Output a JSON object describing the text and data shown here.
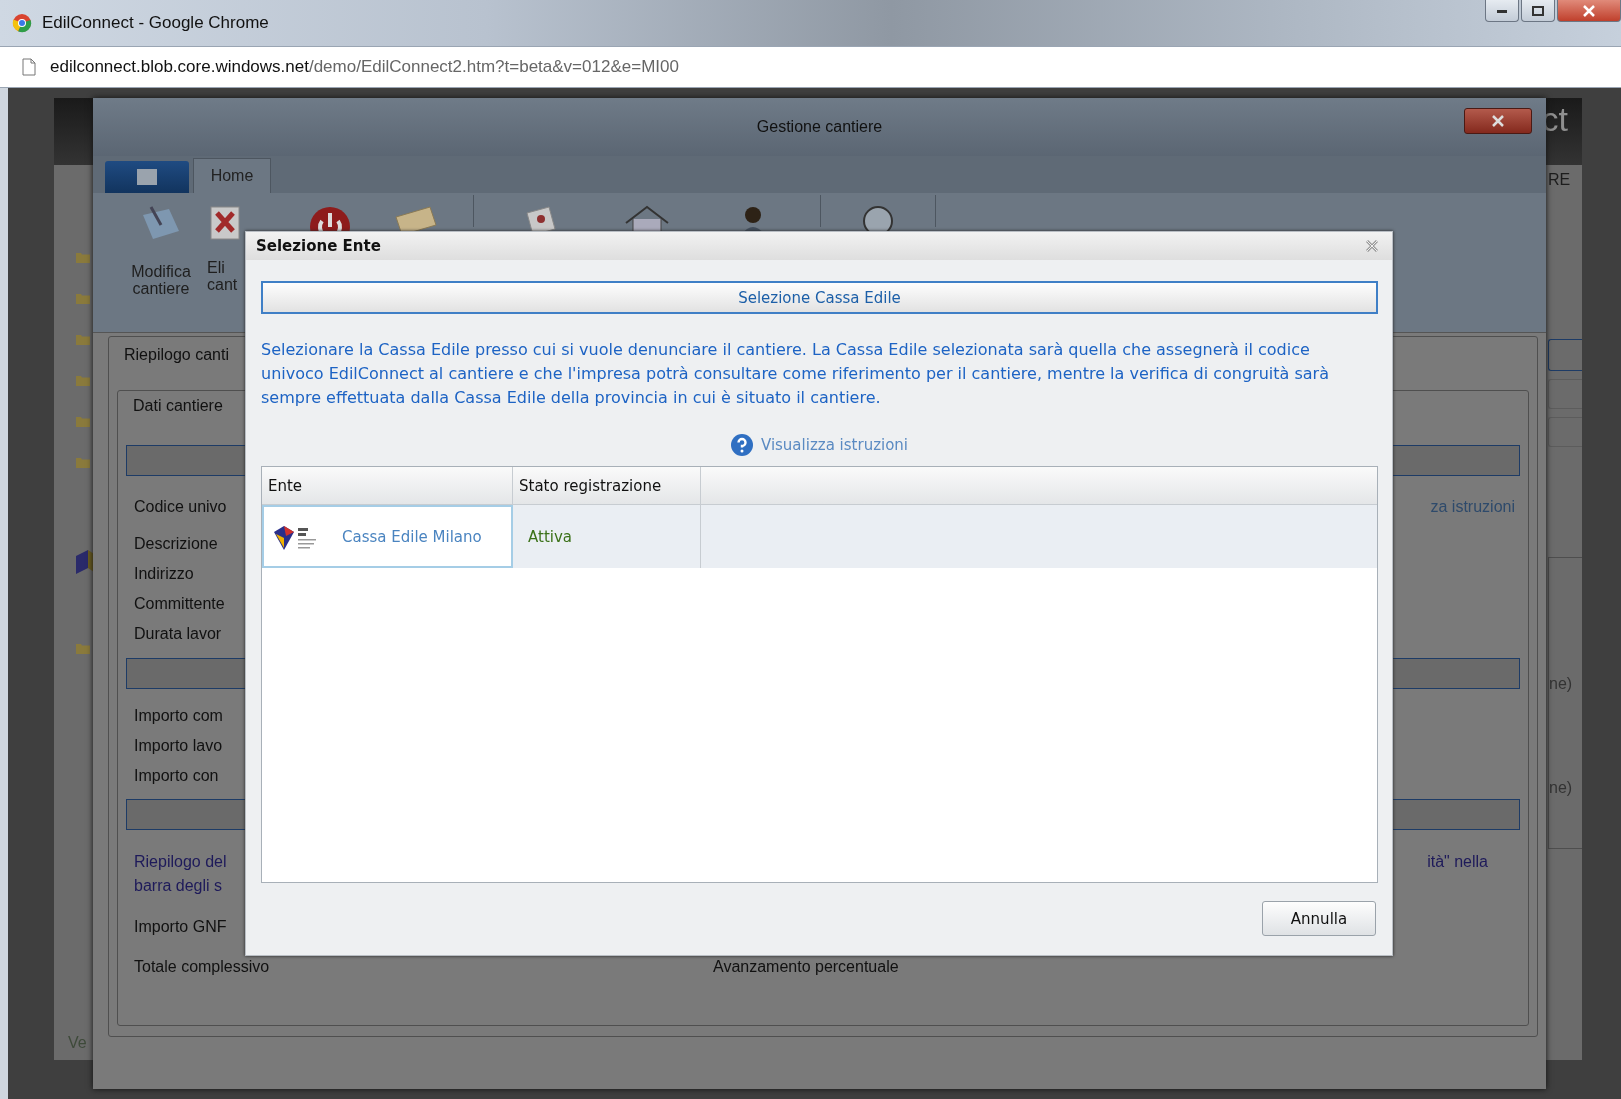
{
  "browser": {
    "title": "EdilConnect - Google Chrome",
    "url_host": "edilconnect.blob.core.windows.net",
    "url_path": "/demo/EdilConnect2.htm?t=beta&v=012&e=MI00"
  },
  "app_background": {
    "logo_fragment": "ct",
    "header_fragment": "RE",
    "status_fragment": "Ve",
    "side_fragments": [
      "ne)",
      "ne)"
    ]
  },
  "main_window": {
    "title": "Gestione cantiere",
    "tabs": [
      {
        "label": "Home",
        "selected": true
      }
    ],
    "ribbon": [
      {
        "kind": "tablet",
        "label": [
          "Modifica",
          "cantiere"
        ]
      },
      {
        "kind": "delete",
        "label": [
          "Eli",
          "cant"
        ]
      },
      {
        "kind": "power"
      },
      {
        "kind": "mail"
      },
      {
        "kind": "separator"
      },
      {
        "kind": "document"
      },
      {
        "kind": "house"
      },
      {
        "kind": "person"
      },
      {
        "kind": "separator"
      },
      {
        "kind": "magnifier"
      },
      {
        "kind": "separator"
      }
    ],
    "summary": {
      "tab": "Riepilogo canti",
      "section": "Dati cantiere",
      "code_label": "Codice univo",
      "help_fragment": "za istruzioni",
      "fields_a": [
        "Descrizione",
        "Indirizzo",
        "Committente",
        "Durata lavor"
      ],
      "fields_b": [
        "Importo com",
        "Importo lavo",
        "Importo con"
      ],
      "note_lines": [
        "Riepilogo del",
        "barra degli s"
      ],
      "note_fragment": "ità\" nella",
      "gnf": "Importo GNF",
      "total": "Totale complessivo",
      "progress": "Avanzamento percentuale"
    }
  },
  "dialog": {
    "title": "Selezione Ente",
    "header": "Selezione Cassa Edile",
    "description": "Selezionare la Cassa Edile presso cui si vuole denunciare il cantiere. La Cassa Edile selezionata sarà quella che assegnerà il codice univoco EdilConnect al cantiere e che l'impresa potrà consultare come riferimento per il cantiere, mentre la verifica di congruità sarà sempre effettuata dalla Cassa Edile della provincia in cui è situato il cantiere.",
    "help_link": "Visualizza istruzioni",
    "columns": [
      "Ente",
      "Stato registrazione"
    ],
    "rows": [
      {
        "ente": "Cassa Edile Milano",
        "stato": "Attiva",
        "selected": true
      }
    ],
    "buttons": [
      "Annulla"
    ]
  }
}
